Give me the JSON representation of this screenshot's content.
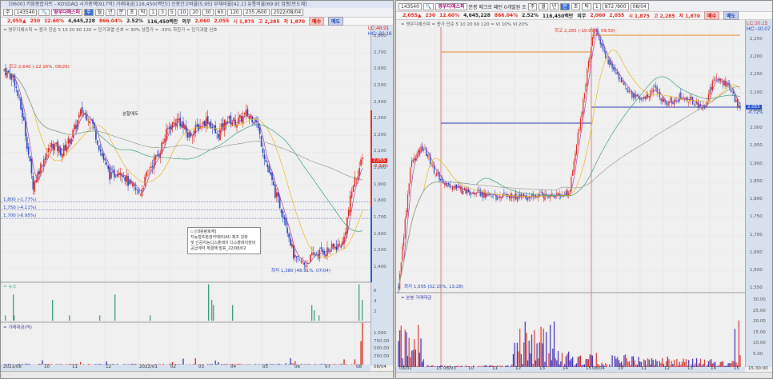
{
  "left": {
    "title": "[0600] 키움종합차트 - KOSDAQ 시가총액[917억] 거래대금[116,450(백만)] 신용잔고비율[5.95] 부채비율[42.1] 유통비율[69.9] 업종[반도체]",
    "toolbar": {
      "period": "주",
      "code": "143540",
      "name": "영우디에스피",
      "units": [
        "주",
        "월",
        "년",
        "분",
        "초",
        "틱"
      ],
      "intervals": [
        "1",
        "3",
        "5",
        "10",
        "20",
        "30",
        "60",
        "120"
      ],
      "count": "235 /600",
      "date": "2022/08/04"
    },
    "price": {
      "last": "2,055▲",
      "change": "230",
      "pct": "12.60%",
      "volume": "4,645,228",
      "vol_pct": "866.04%",
      "turnover": "2.52%",
      "amount": "116,450백만",
      "label": "외무",
      "ask": "2,060",
      "bid": "2,055",
      "open": "시 1,875",
      "high": "고 2,285",
      "low": "저 1,870",
      "buy": "매수",
      "sell": "매도"
    },
    "legend": "= 영우디에스피 = 종가 단순 5 10 20 60 120 = 단기과열 신호 = 30% 상한가 = -30% 하한가 = 단기과열 신호",
    "lc": "LC:48.91",
    "hc": "HC:-32.16",
    "annotations": {
      "high": "최고 2,640 (-22.16%, 08/26)",
      "split": "분할매도",
      "low": "최저 1,380 (48.91%, 07/04)",
      "l1800": "1,800 (-1.77%)",
      "l1750": "1,750 (-4.11%)",
      "l1700": "1,700 (-6.95%)"
    },
    "note": {
      "title": "◇ [대용량호재]",
      "lines": [
        "지능형초분광카메라(AI) 제조 강화",
        "및 인공지능디스플레이 디스플레이장비",
        "공급계약 체결해 발표_22/08/02"
      ]
    },
    "price_tag": "2,055",
    "price_tag_pct": "-0.24%",
    "y_ticks": [
      "2,800",
      "2,700",
      "2,600",
      "2,500",
      "2,400",
      "2,300",
      "2,200",
      "2,100",
      "2,000",
      "1,900",
      "1,800",
      "1,700",
      "1,600",
      "1,500",
      "1,400"
    ],
    "news_label": "= 뉴스",
    "news_ticks": [
      "6",
      "4",
      "2"
    ],
    "amount_label": "= 거래대금(억)",
    "amount_ticks": [
      "1,000",
      "750.00",
      "500.00",
      "250.00"
    ],
    "dates": [
      "2021/08",
      "10",
      "11",
      "12",
      "2022/01",
      "02",
      "03",
      "04",
      "05",
      "06",
      "07",
      "08"
    ],
    "axis_end": "08/04"
  },
  "right": {
    "toolbar": {
      "code": "143540",
      "name": "영우디에스피",
      "pattern": "분봉 매크로 패턴 0개발원 조",
      "units": [
        "주",
        "월",
        "년",
        "분",
        "초",
        "틱"
      ],
      "interval": "1",
      "count": "872 /900",
      "date": "08/04"
    },
    "price": {
      "last": "2,055▲",
      "change": "230",
      "pct": "12.60%",
      "volume": "4,645,228",
      "vol_pct": "866.04%",
      "turnover": "2.52%",
      "amount": "116,450백만",
      "label": "외무",
      "ask": "2,060",
      "bid": "2,055",
      "open": "시 1,875",
      "high": "고 2,285",
      "low": "저 1,870",
      "buy": "매수",
      "sell": "매도"
    },
    "legend": "= 영우디에스피 = 종가 단순 5 10 20 60 120 = VI 10% VI 20%",
    "lc": "LC:30.15",
    "hc": "HC:-10.07",
    "annotations": {
      "high": "최고 2,285 (-10.07%, 09:50)",
      "low": "최저 1,555 (32.15%, 13:28)"
    },
    "price_tag": "2,055",
    "price_tag_pct": "-0.72%",
    "y_ticks": [
      "2,250",
      "2,200",
      "2,150",
      "2,100",
      "2,050",
      "2,000",
      "1,950",
      "1,900",
      "1,850",
      "1,800",
      "1,750",
      "1,700",
      "1,650",
      "1,600",
      "1,550"
    ],
    "amount_label": "= 분봉 거래대금",
    "amount_ticks": [
      "30.00",
      "25.00",
      "20.00",
      "15.00",
      "10.00",
      "5.00"
    ],
    "dates": [
      "08/02",
      "15",
      "08/03",
      "10",
      "11",
      "12",
      "13",
      "14",
      "15",
      "08/04",
      "10",
      "11",
      "12",
      "13",
      "14",
      "15"
    ],
    "axis_end": "15:30:00"
  },
  "chart_data": [
    {
      "type": "candlestick",
      "title": "영우디에스피 일봉",
      "ylim": [
        1350,
        2900
      ],
      "x_range": [
        "2021/08",
        "2022/08/04"
      ],
      "close_path": [
        2600,
        2550,
        2300,
        1900,
        2050,
        2150,
        2100,
        2200,
        2350,
        2300,
        2100,
        1950,
        2000,
        1900,
        1850,
        2000,
        2100,
        2250,
        2300,
        2200,
        2250,
        2300,
        2200,
        2300,
        2280,
        2330,
        2300,
        2050,
        1850,
        1700,
        1450,
        1420,
        1480,
        1500,
        1520,
        1550,
        1900,
        2055
      ],
      "news_counts": [
        1,
        5,
        1,
        4,
        1,
        1,
        5,
        1,
        7,
        4,
        3,
        3,
        3,
        2,
        1,
        7,
        4
      ]
    },
    {
      "type": "candlestick",
      "title": "영우디에스피 1분봉",
      "ylim": [
        1540,
        2300
      ],
      "days": [
        "08/02",
        "08/03",
        "08/04"
      ],
      "close_path": [
        1555,
        1900,
        1950,
        1880,
        1840,
        1830,
        1820,
        1815,
        1810,
        1812,
        1808,
        1810,
        1815,
        1812,
        1820,
        2050,
        2285,
        2200,
        2150,
        2100,
        2080,
        2110,
        2070,
        2090,
        2080,
        2060,
        2150,
        2120,
        2055
      ]
    }
  ]
}
